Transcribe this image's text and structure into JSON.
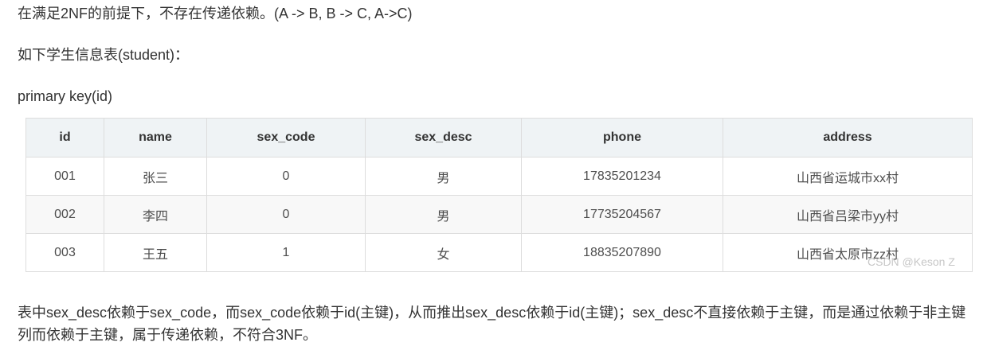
{
  "paragraphs": {
    "p1": "在满足2NF的前提下，不存在传递依赖。(A -> B, B -> C, A->C)",
    "p2": "如下学生信息表(student)：",
    "p3": "primary key(id)",
    "p4": "表中sex_desc依赖于sex_code，而sex_code依赖于id(主键)，从而推出sex_desc依赖于id(主键)；sex_desc不直接依赖于主键，而是通过依赖于非主键列而依赖于主键，属于传递依赖，不符合3NF。"
  },
  "table": {
    "columns": [
      "id",
      "name",
      "sex_code",
      "sex_desc",
      "phone",
      "address"
    ],
    "rows": [
      [
        "001",
        "张三",
        "0",
        "男",
        "17835201234",
        "山西省运城市xx村"
      ],
      [
        "002",
        "李四",
        "0",
        "男",
        "17735204567",
        "山西省吕梁市yy村"
      ],
      [
        "003",
        "王五",
        "1",
        "女",
        "18835207890",
        "山西省太原市zz村"
      ]
    ]
  },
  "watermark": "CSDN @Keson Z"
}
